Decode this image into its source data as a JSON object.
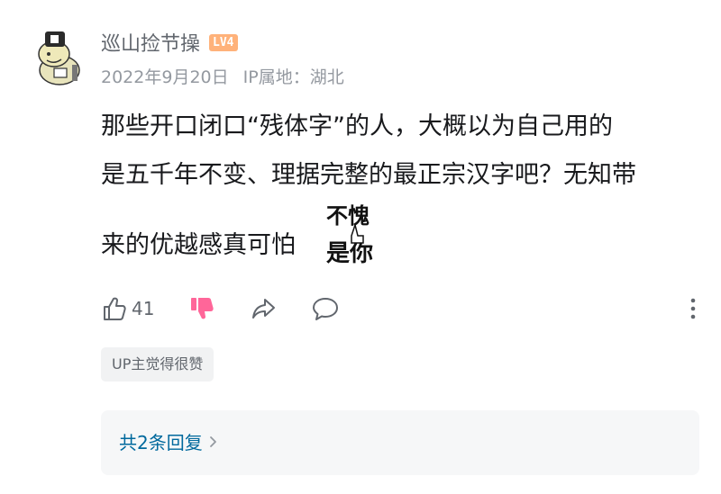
{
  "comment": {
    "username": "巡山捡节操",
    "level": "LV4",
    "date": "2022年9月20日",
    "ip_location": "IP属地：湖北",
    "text_line1": "那些开口闭口“残体字”的人，大概以为自己用的",
    "text_line2": "是五千年不变、理据完整的最正宗汉字吧？无知带",
    "text_line3": "来的优越感真可怕",
    "sticker_text_top": "不愧",
    "sticker_text_bottom": "是你",
    "like_count": "41",
    "up_tag": "UP主觉得很赞",
    "replies_label": "共2条回复"
  },
  "icons": {
    "like": "thumbs-up-icon",
    "dislike": "thumbs-down-icon",
    "share": "share-icon",
    "reply": "comment-icon",
    "more": "more-vertical-icon",
    "chevron": "chevron-right-icon"
  },
  "colors": {
    "username": "#61666d",
    "meta": "#9499a0",
    "level_badge": "#ffb27a",
    "dislike_active": "#ff6699",
    "reply_link": "#00699d",
    "reply_bg": "#f6f7f8"
  }
}
